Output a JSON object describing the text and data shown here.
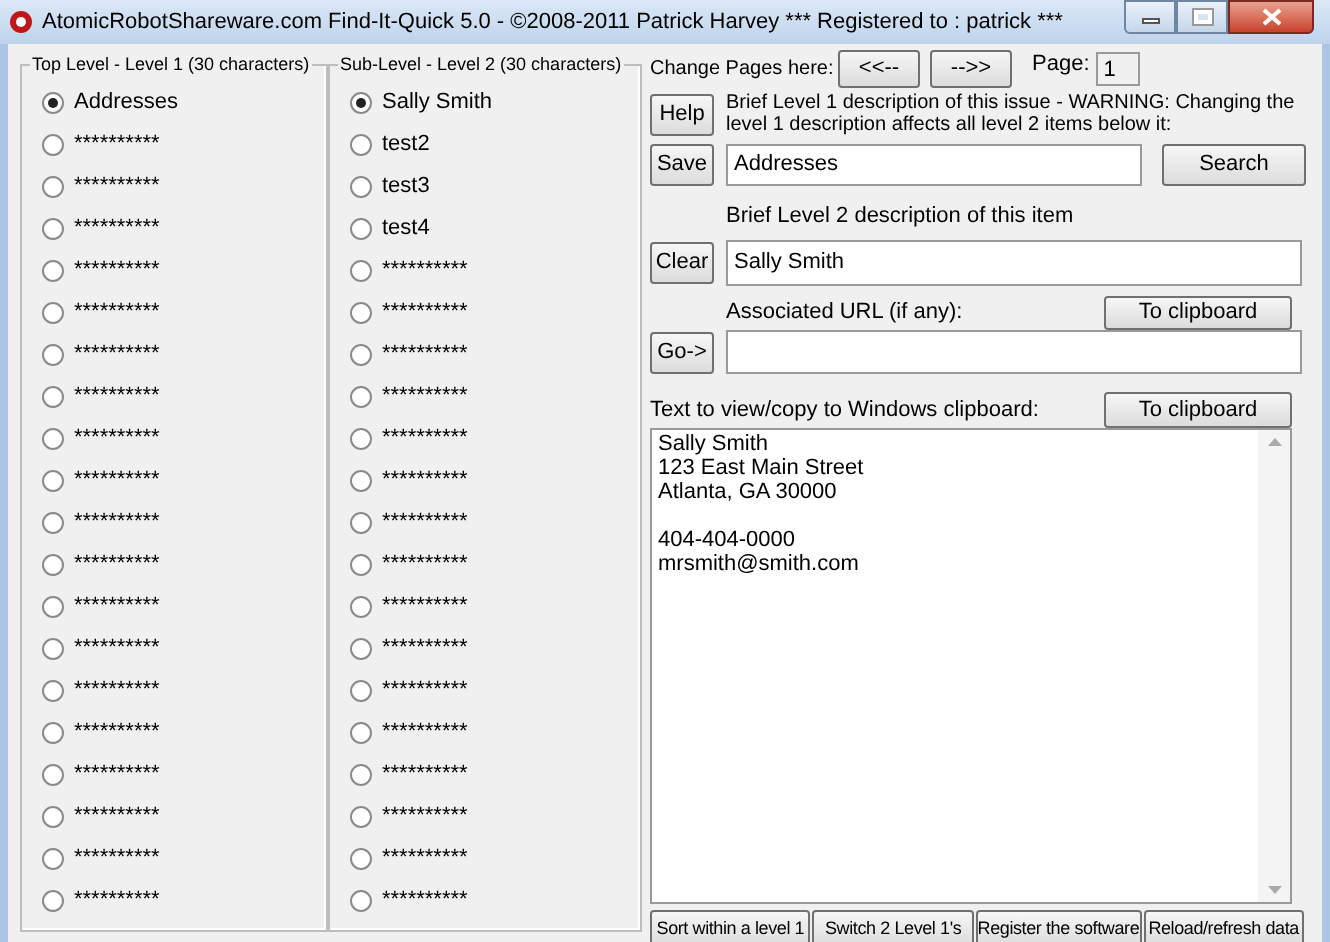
{
  "window": {
    "title": "AtomicRobotShareware.com Find-It-Quick 5.0 - ©2008-2011 Patrick Harvey *** Registered to : patrick ***"
  },
  "top_level": {
    "title": "Top Level - Level 1 (30 characters)",
    "items": [
      {
        "label": "Addresses",
        "selected": true
      },
      {
        "label": "**********",
        "selected": false
      },
      {
        "label": "**********",
        "selected": false
      },
      {
        "label": "**********",
        "selected": false
      },
      {
        "label": "**********",
        "selected": false
      },
      {
        "label": "**********",
        "selected": false
      },
      {
        "label": "**********",
        "selected": false
      },
      {
        "label": "**********",
        "selected": false
      },
      {
        "label": "**********",
        "selected": false
      },
      {
        "label": "**********",
        "selected": false
      },
      {
        "label": "**********",
        "selected": false
      },
      {
        "label": "**********",
        "selected": false
      },
      {
        "label": "**********",
        "selected": false
      },
      {
        "label": "**********",
        "selected": false
      },
      {
        "label": "**********",
        "selected": false
      },
      {
        "label": "**********",
        "selected": false
      },
      {
        "label": "**********",
        "selected": false
      },
      {
        "label": "**********",
        "selected": false
      },
      {
        "label": "**********",
        "selected": false
      },
      {
        "label": "**********",
        "selected": false
      }
    ]
  },
  "sub_level": {
    "title": "Sub-Level - Level 2 (30 characters)",
    "items": [
      {
        "label": "Sally Smith",
        "selected": true
      },
      {
        "label": "test2",
        "selected": false
      },
      {
        "label": "test3",
        "selected": false
      },
      {
        "label": "test4",
        "selected": false
      },
      {
        "label": "**********",
        "selected": false
      },
      {
        "label": "**********",
        "selected": false
      },
      {
        "label": "**********",
        "selected": false
      },
      {
        "label": "**********",
        "selected": false
      },
      {
        "label": "**********",
        "selected": false
      },
      {
        "label": "**********",
        "selected": false
      },
      {
        "label": "**********",
        "selected": false
      },
      {
        "label": "**********",
        "selected": false
      },
      {
        "label": "**********",
        "selected": false
      },
      {
        "label": "**********",
        "selected": false
      },
      {
        "label": "**********",
        "selected": false
      },
      {
        "label": "**********",
        "selected": false
      },
      {
        "label": "**********",
        "selected": false
      },
      {
        "label": "**********",
        "selected": false
      },
      {
        "label": "**********",
        "selected": false
      },
      {
        "label": "**********",
        "selected": false
      }
    ]
  },
  "pages": {
    "label": "Change Pages here:",
    "prev": "<<--",
    "next": "-->>",
    "page_label": "Page:",
    "page": "1"
  },
  "help_button": "Help",
  "level1": {
    "description": "Brief Level 1 description of this issue - WARNING: Changing the level 1 description affects all level 2 items below it:",
    "save_button": "Save",
    "value": "Addresses",
    "search_button": "Search"
  },
  "level2": {
    "label": "Brief Level 2 description of this item",
    "clear_button": "Clear",
    "value": "Sally Smith"
  },
  "url": {
    "label": "Associated URL (if any):",
    "clipboard_button": "To clipboard",
    "go_button": "Go->"
  },
  "clipboard": {
    "label": "Text to view/copy to Windows clipboard:",
    "clipboard_button": "To clipboard",
    "paragraphs": [
      [
        "Sally Smith",
        "123 East Main Street",
        "Atlanta, GA  30000"
      ],
      [
        "404-404-0000",
        "mrsmith@smith.com"
      ]
    ]
  },
  "bottom_buttons": [
    "Sort within a level 1",
    "Switch 2 Level 1's",
    "Register the software",
    "Reload/refresh data"
  ]
}
